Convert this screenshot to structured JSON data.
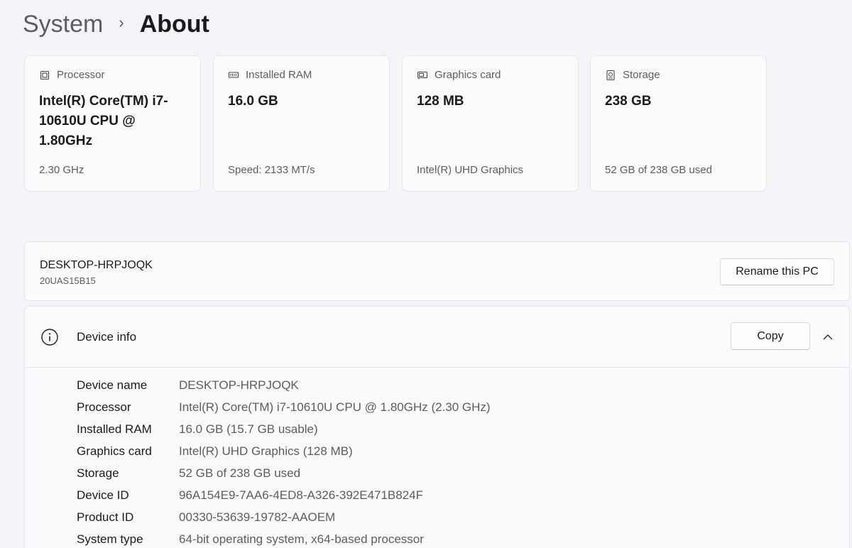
{
  "breadcrumb": {
    "parent": "System",
    "separator": "›",
    "current": "About"
  },
  "cards": [
    {
      "icon": "processor-icon",
      "title": "Processor",
      "value": "Intel(R) Core(TM) i7-10610U CPU @ 1.80GHz",
      "sub": "2.30 GHz"
    },
    {
      "icon": "ram-icon",
      "title": "Installed RAM",
      "value": "16.0 GB",
      "sub": "Speed: 2133 MT/s"
    },
    {
      "icon": "graphics-card-icon",
      "title": "Graphics card",
      "value": "128 MB",
      "sub": "Intel(R) UHD Graphics"
    },
    {
      "icon": "storage-icon",
      "title": "Storage",
      "value": "238 GB",
      "sub": "52 GB of 238 GB used"
    }
  ],
  "pc": {
    "name": "DESKTOP-HRPJOQK",
    "model": "20UAS15B15",
    "rename_label": "Rename this PC"
  },
  "device_info": {
    "title": "Device info",
    "copy_label": "Copy",
    "rows": [
      {
        "label": "Device name",
        "value": "DESKTOP-HRPJOQK"
      },
      {
        "label": "Processor",
        "value": "Intel(R) Core(TM) i7-10610U CPU @ 1.80GHz (2.30 GHz)"
      },
      {
        "label": "Installed RAM",
        "value": "16.0 GB (15.7 GB usable)"
      },
      {
        "label": "Graphics card",
        "value": "Intel(R) UHD Graphics (128 MB)"
      },
      {
        "label": "Storage",
        "value": "52 GB of 238 GB used"
      },
      {
        "label": "Device ID",
        "value": "96A154E9-7AA6-4ED8-A326-392E471B824F"
      },
      {
        "label": "Product ID",
        "value": "00330-53639-19782-AAOEM"
      },
      {
        "label": "System type",
        "value": "64-bit operating system, x64-based processor"
      }
    ]
  }
}
